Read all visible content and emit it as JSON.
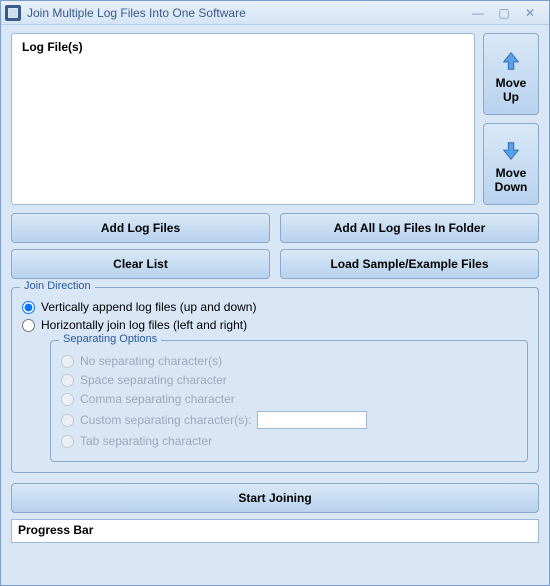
{
  "window": {
    "title": "Join Multiple Log Files Into One Software"
  },
  "logbox": {
    "header": "Log File(s)"
  },
  "moveUp": {
    "line1": "Move",
    "line2": "Up"
  },
  "moveDown": {
    "line1": "Move",
    "line2": "Down"
  },
  "buttons": {
    "addFiles": "Add Log Files",
    "addFolder": "Add All Log Files In Folder",
    "clear": "Clear List",
    "loadSample": "Load Sample/Example Files"
  },
  "joinDirection": {
    "legend": "Join Direction",
    "vertical": "Vertically append log files (up and down)",
    "horizontal": "Horizontally join log files (left and right)"
  },
  "separating": {
    "legend": "Separating Options",
    "none": "No separating character(s)",
    "space": "Space separating character",
    "comma": "Comma separating character",
    "custom": "Custom separating character(s):",
    "tab": "Tab separating character"
  },
  "start": "Start Joining",
  "progress": "Progress Bar"
}
